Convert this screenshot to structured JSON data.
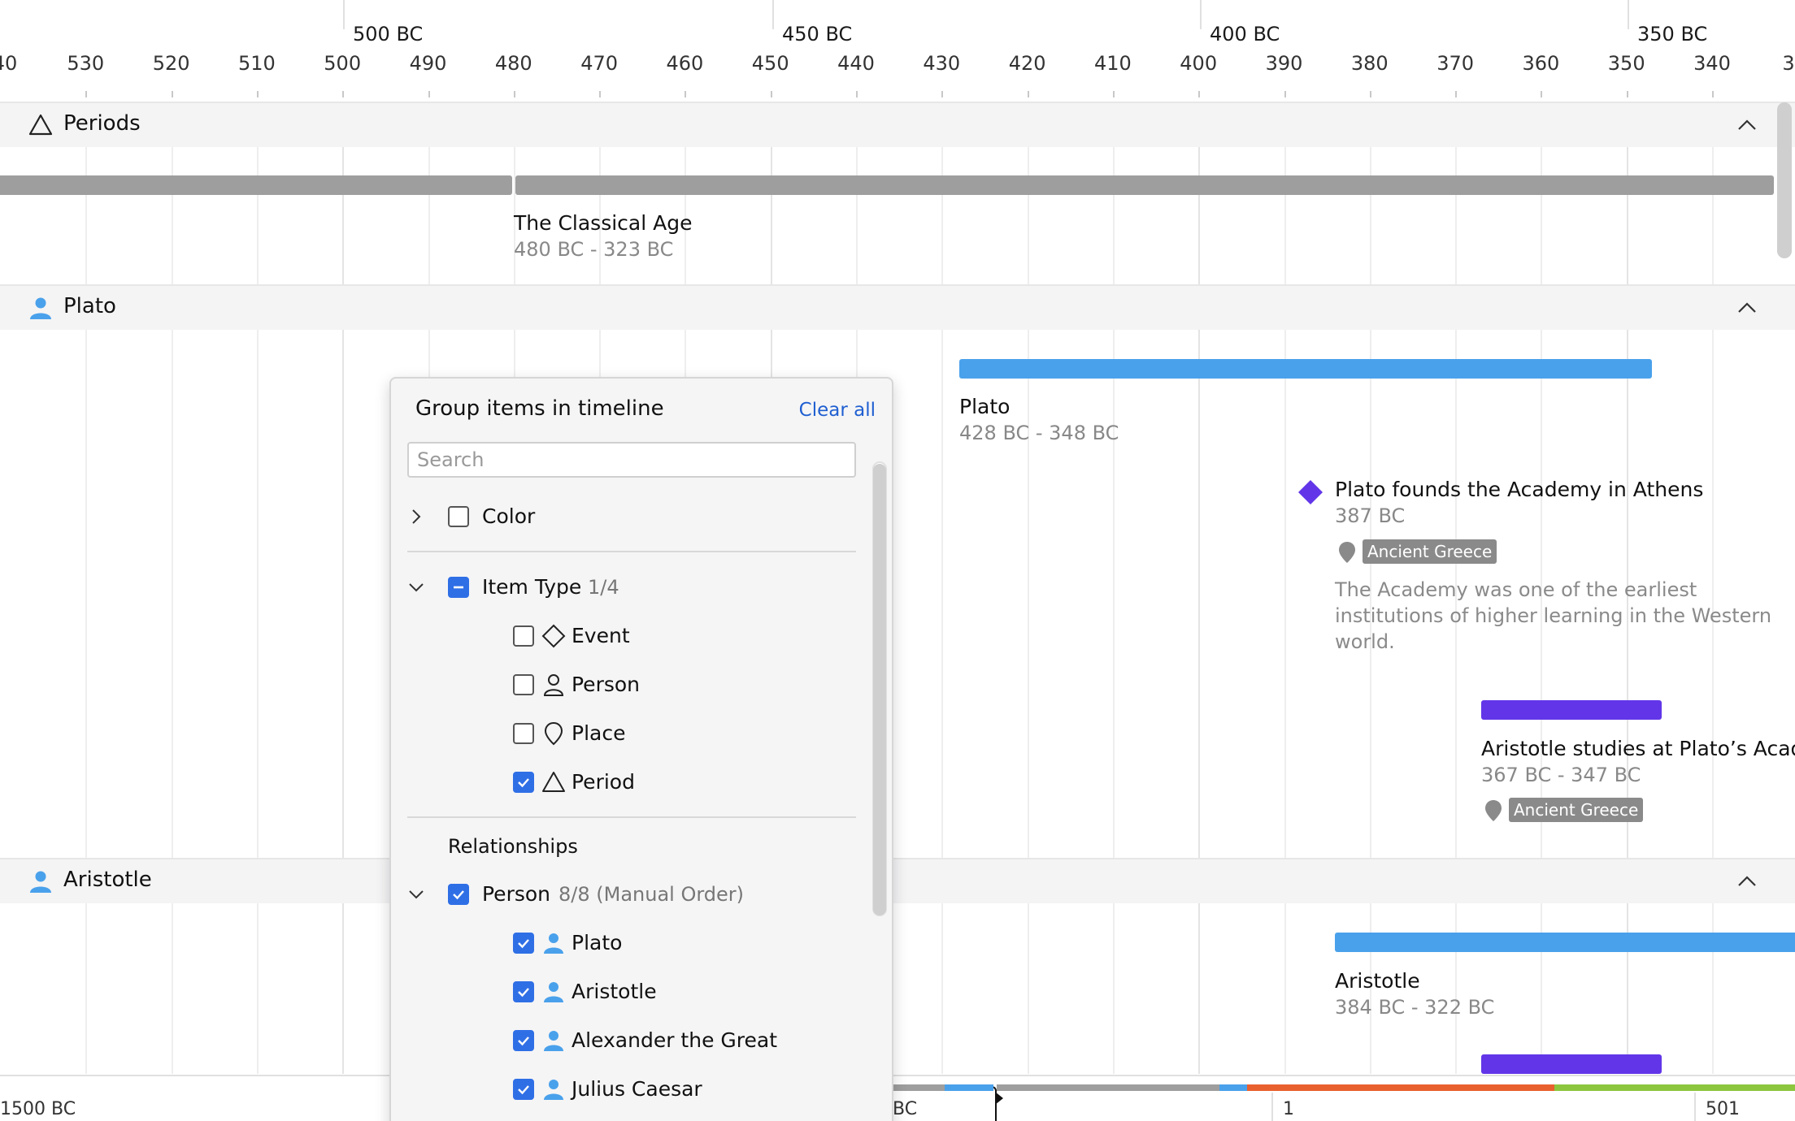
{
  "colors": {
    "accent_blue": "#4aa1eb",
    "event_purple": "#6236e8",
    "period_gray": "#9e9e9e",
    "checkbox_blue": "#2f6fe6",
    "link_blue": "#1f5fd1",
    "overview_orange": "#e9602f",
    "overview_green": "#8cc63e"
  },
  "axis": {
    "major": [
      "500 BC",
      "450 BC",
      "400 BC",
      "350 BC"
    ],
    "minor": [
      "40",
      "530",
      "520",
      "510",
      "500",
      "490",
      "480",
      "470",
      "460",
      "450",
      "440",
      "430",
      "420",
      "410",
      "400",
      "390",
      "380",
      "370",
      "360",
      "350",
      "340",
      "3"
    ]
  },
  "groups": [
    {
      "title": "Periods",
      "icon": "triangle-icon"
    },
    {
      "title": "Plato",
      "icon": "person-icon"
    },
    {
      "title": "Aristotle",
      "icon": "person-icon"
    }
  ],
  "items": {
    "classical_age": {
      "title": "The Classical Age",
      "date": "480 BC - 323 BC"
    },
    "plato": {
      "title": "Plato",
      "date": "428 BC - 348 BC"
    },
    "academy": {
      "title": "Plato founds the Academy in Athens",
      "date": "387 BC",
      "place": "Ancient Greece",
      "description": "The Academy was one of the earliest institutions of higher learning in the Western world."
    },
    "aristotle_studies": {
      "title": "Aristotle studies at Plato’s Acade",
      "date": "367 BC - 347 BC",
      "place": "Ancient Greece"
    },
    "aristotle": {
      "title": "Aristotle",
      "date": "384 BC - 322 BC"
    }
  },
  "bottom_axis": {
    "labels": [
      "1500 BC",
      "BC",
      "1",
      "501"
    ]
  },
  "panel": {
    "title": "Group items in timeline",
    "clear_all": "Clear all",
    "search_placeholder": "Search",
    "color_label": "Color",
    "item_type": {
      "label": "Item Type",
      "count": "1/4"
    },
    "types": [
      {
        "label": "Event",
        "icon": "diamond-icon",
        "checked": false
      },
      {
        "label": "Person",
        "icon": "person-outline-icon",
        "checked": false
      },
      {
        "label": "Place",
        "icon": "pin-outline-icon",
        "checked": false
      },
      {
        "label": "Period",
        "icon": "triangle-icon",
        "checked": true
      }
    ],
    "relationships_label": "Relationships",
    "person_group": {
      "label": "Person",
      "count": "8/8 (Manual Order)"
    },
    "people": [
      {
        "label": "Plato",
        "checked": true
      },
      {
        "label": "Aristotle",
        "checked": true
      },
      {
        "label": "Alexander the Great",
        "checked": true
      },
      {
        "label": "Julius Caesar",
        "checked": true
      }
    ]
  }
}
